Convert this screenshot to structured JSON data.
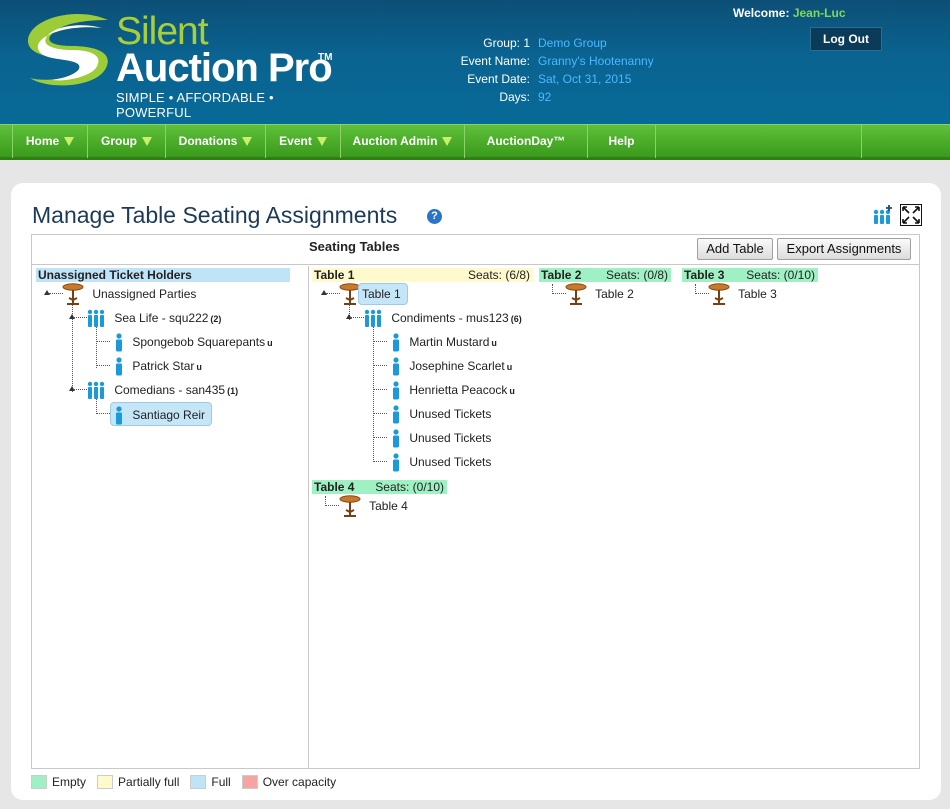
{
  "header": {
    "logo": {
      "line1": "Silent",
      "line2": "Auction Pro",
      "tm": "TM",
      "tagline": "SIMPLE • AFFORDABLE • POWERFUL"
    },
    "welcome_label": "Welcome:",
    "user_name": "Jean-Luc",
    "logout_label": "Log Out",
    "event_info": [
      {
        "label": "Group: 1",
        "value": "Demo Group"
      },
      {
        "label": "Event Name:",
        "value": "Granny's Hootenanny"
      },
      {
        "label": "Event Date:",
        "value": "Sat, Oct 31, 2015"
      },
      {
        "label": "Days:",
        "value": "92"
      }
    ]
  },
  "nav": [
    {
      "label": "Home",
      "has_menu": true
    },
    {
      "label": "Group",
      "has_menu": true
    },
    {
      "label": "Donations",
      "has_menu": true
    },
    {
      "label": "Event",
      "has_menu": true
    },
    {
      "label": "Auction Admin",
      "has_menu": true
    },
    {
      "label": "AuctionDay™",
      "has_menu": false
    },
    {
      "label": "Help",
      "has_menu": false
    }
  ],
  "page": {
    "title": "Manage Table Seating Assignments",
    "help_icon": "help-icon"
  },
  "toolbar": {
    "heading": "Seating Tables",
    "add_table": "Add Table",
    "export": "Export Assignments"
  },
  "unassigned": {
    "header": "Unassigned Ticket Holders",
    "root": "Unassigned Parties",
    "groups": [
      {
        "name": "Sea Life - squ222",
        "count": "(2)",
        "members": [
          {
            "name": "Spongebob Squarepants",
            "flag": "u"
          },
          {
            "name": "Patrick Star",
            "flag": "u"
          }
        ]
      },
      {
        "name": "Comedians - san435",
        "count": "(1)",
        "members": [
          {
            "name": "Santiago Reir",
            "flag": ""
          }
        ]
      }
    ]
  },
  "tables": [
    {
      "label": "Table 1",
      "seats": "Seats: (6/8)",
      "status": "partially-full",
      "node": "Table 1",
      "group": {
        "name": "Condiments - mus123",
        "count": "(6)"
      },
      "members": [
        {
          "name": "Martin Mustard",
          "flag": "u"
        },
        {
          "name": "Josephine Scarlet",
          "flag": "u"
        },
        {
          "name": "Henrietta Peacock",
          "flag": "u"
        },
        {
          "name": "Unused Tickets",
          "flag": ""
        },
        {
          "name": "Unused Tickets",
          "flag": ""
        },
        {
          "name": "Unused Tickets",
          "flag": ""
        }
      ]
    },
    {
      "label": "Table 2",
      "seats": "Seats: (0/8)",
      "status": "empty",
      "node": "Table 2"
    },
    {
      "label": "Table 3",
      "seats": "Seats: (0/10)",
      "status": "empty",
      "node": "Table 3"
    },
    {
      "label": "Table 4",
      "seats": "Seats: (0/10)",
      "status": "empty",
      "node": "Table 4"
    }
  ],
  "legend": [
    {
      "label": "Empty",
      "color": "#9ff0c2"
    },
    {
      "label": "Partially full",
      "color": "#fffacd"
    },
    {
      "label": "Full",
      "color": "#bfe3f7"
    },
    {
      "label": "Over capacity",
      "color": "#f5a3a3"
    }
  ],
  "colors": {
    "header_blue": "#0a6390",
    "nav_green": "#3a9a1c",
    "link_blue": "#4cb8ff",
    "person_icon": "#1a9ad9"
  }
}
